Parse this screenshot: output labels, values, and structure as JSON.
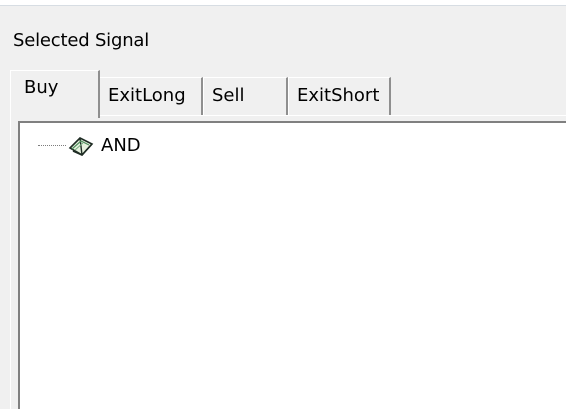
{
  "signal_panel": {
    "title": "Selected Signal",
    "tabs": [
      {
        "label": "Buy",
        "active": true
      },
      {
        "label": "ExitLong",
        "active": false
      },
      {
        "label": "Sell",
        "active": false
      },
      {
        "label": "ExitShort",
        "active": false
      }
    ],
    "tree": {
      "items": [
        {
          "label": "AND",
          "icon": "book-icon"
        }
      ]
    }
  },
  "colors": {
    "window_bg": "#f0f0f0",
    "tree_bg": "#ffffff",
    "border_shadow": "#808080"
  }
}
